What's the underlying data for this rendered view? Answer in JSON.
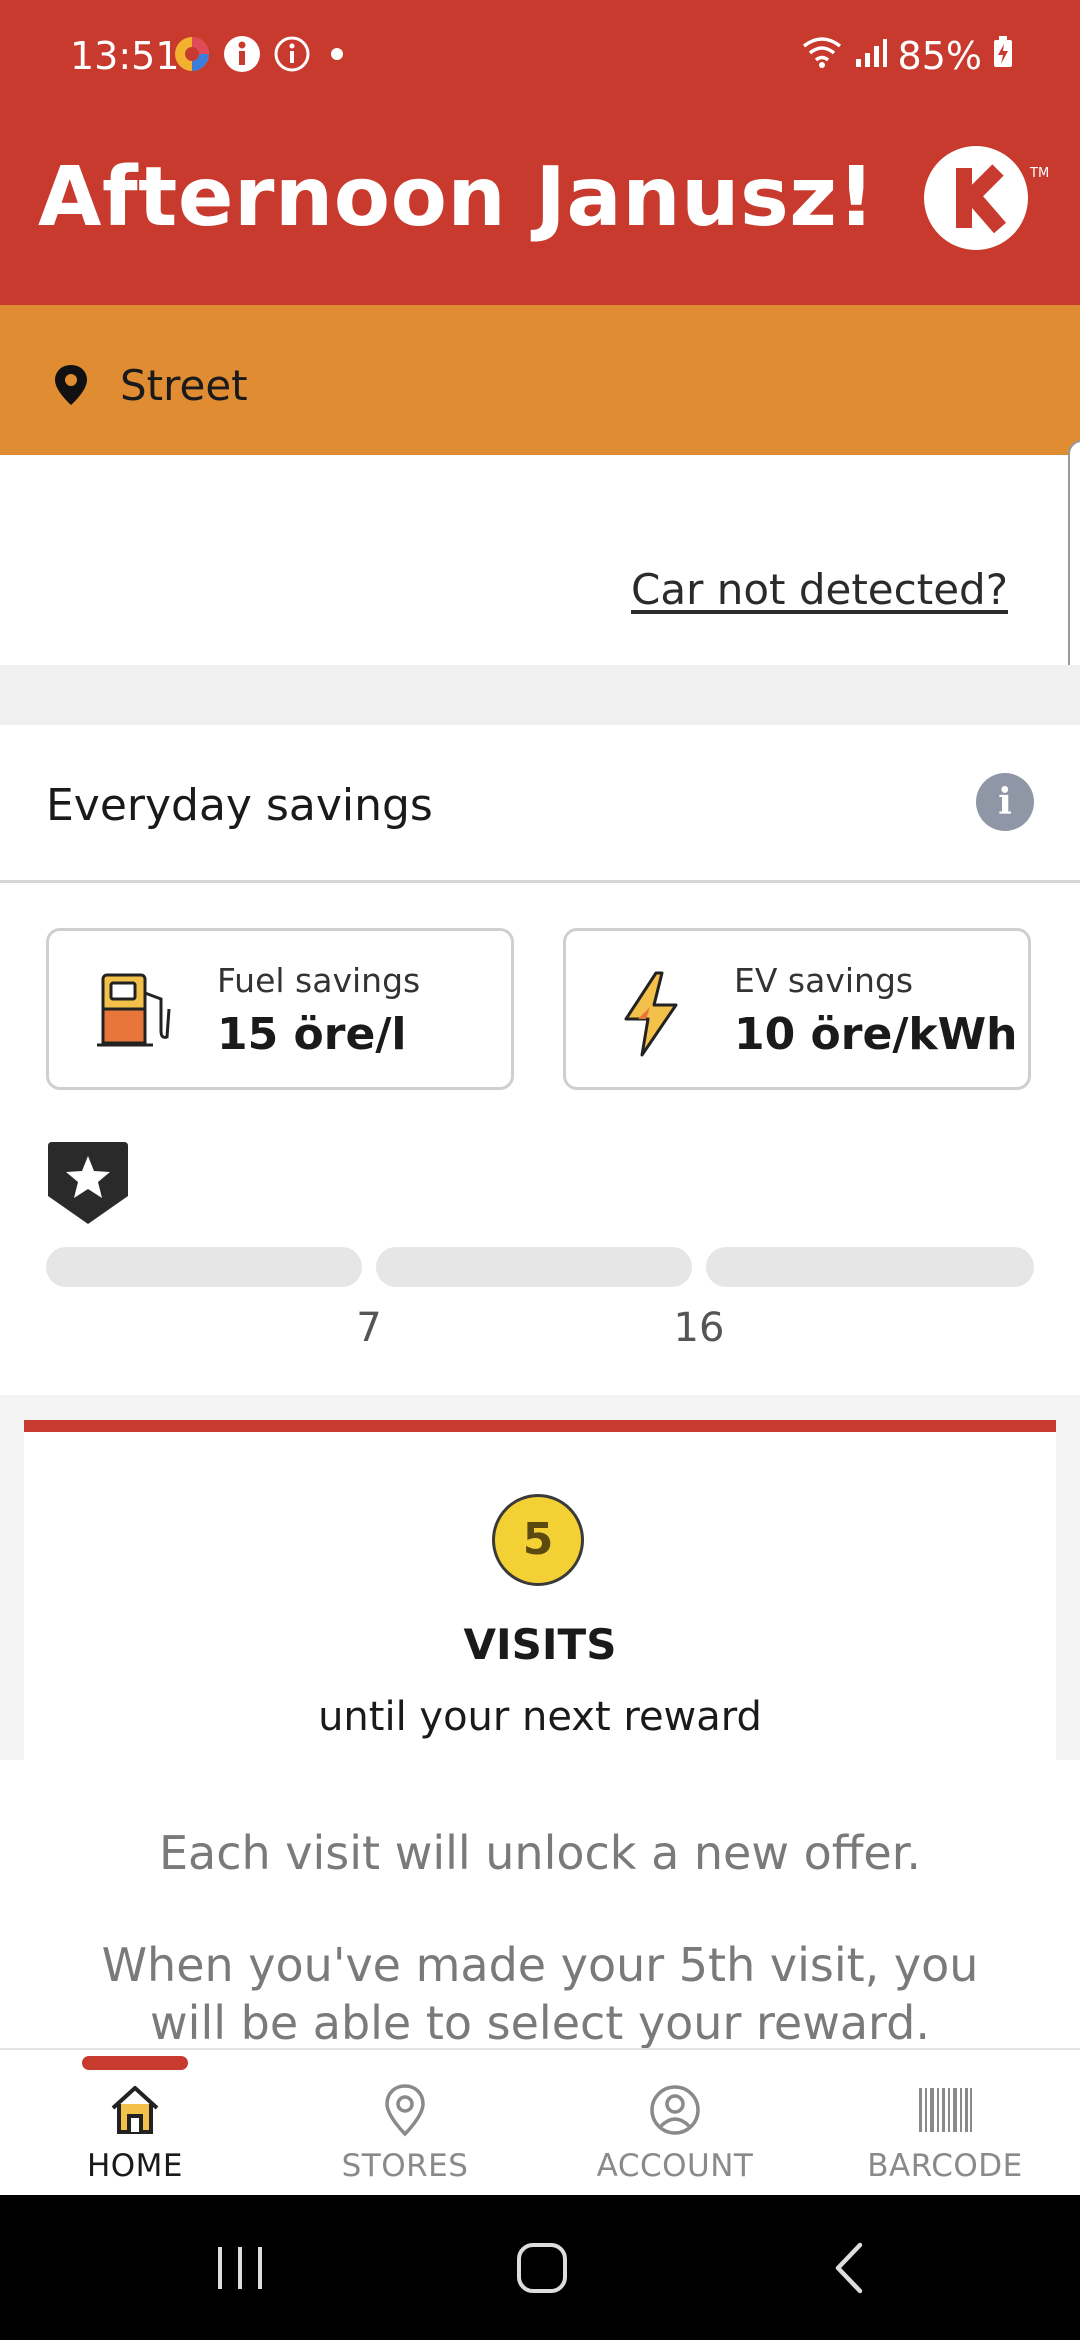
{
  "status_bar": {
    "time": "13:51",
    "battery": "85%",
    "icons": [
      "app-notification-icon",
      "info-filled-icon",
      "info-outline-icon",
      "dot-icon",
      "wifi-icon",
      "signal-icon",
      "battery-charging-icon"
    ]
  },
  "header": {
    "greeting": "Afternoon Janusz!",
    "logo_letter": "K"
  },
  "location": {
    "label": "Street",
    "icon": "location-pin-icon"
  },
  "car": {
    "link_text": "Car not detected?"
  },
  "savings": {
    "title": "Everyday savings",
    "info_icon_glyph": "i",
    "fuel": {
      "label": "Fuel savings",
      "value": "15 öre/l",
      "icon": "fuel-pump-icon"
    },
    "ev": {
      "label": "EV savings",
      "value": "10 öre/kWh",
      "icon": "lightning-bolt-icon"
    },
    "progress": {
      "badge_icon": "star-icon",
      "segments": 3,
      "filled_fraction": 0,
      "milestones": [
        "7",
        "16"
      ]
    }
  },
  "visits": {
    "count": "5",
    "label": "VISITS",
    "subtitle": "until your next reward"
  },
  "info_sheet": {
    "line1": "Each visit will unlock a new offer.",
    "line2": "When you've made your 5th visit, you will be able to select your reward."
  },
  "bottom_nav": {
    "active": "home",
    "items": [
      {
        "label": "HOME",
        "icon": "home-icon"
      },
      {
        "label": "STORES",
        "icon": "map-pin-icon"
      },
      {
        "label": "ACCOUNT",
        "icon": "account-icon"
      },
      {
        "label": "BARCODE",
        "icon": "barcode-icon"
      }
    ]
  },
  "colors": {
    "brand_red": "#C83A2E",
    "location_orange": "#E08C33",
    "visit_yellow": "#F3D033"
  }
}
